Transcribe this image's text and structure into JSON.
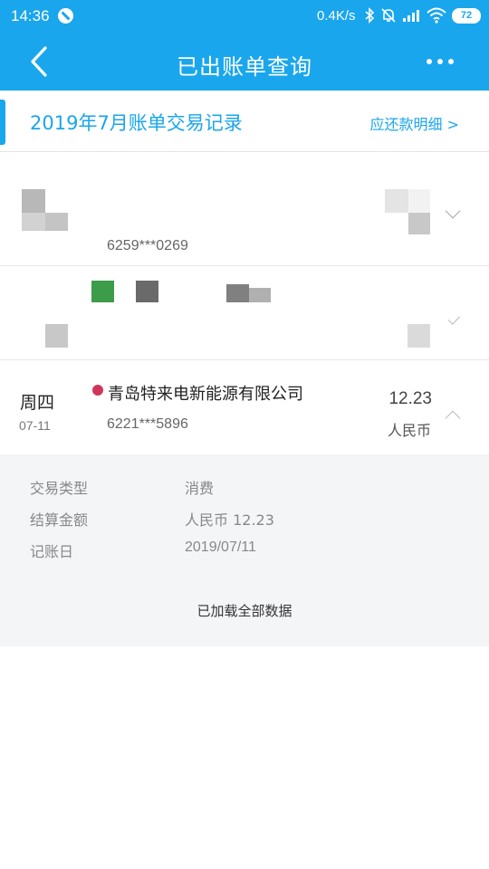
{
  "status_bar": {
    "time": "14:36",
    "network_speed": "0.4K/s",
    "battery": "72",
    "icons": [
      "notification-icon",
      "bluetooth-icon",
      "mute-icon",
      "signal-icon",
      "wifi-icon",
      "battery-icon"
    ]
  },
  "nav": {
    "title": "已出账单查询",
    "back_icon": "chevron-left-icon",
    "more_icon": "more-icon"
  },
  "bill": {
    "month_title": "2019年7月账单交易记录",
    "repay_link": "应还款明细 >"
  },
  "transactions": [
    {
      "card": "6259***0269",
      "expanded": false,
      "redacted": true
    },
    {
      "card": "",
      "expanded": false,
      "redacted": true
    },
    {
      "weekday": "周四",
      "date": "07-11",
      "merchant": "青岛特来电新能源有限公司",
      "card": "6221***5896",
      "amount": "12.23",
      "currency": "人民币",
      "expanded": true
    }
  ],
  "details": {
    "rows": [
      {
        "label": "交易类型",
        "value": "消费"
      },
      {
        "label": "结算金额",
        "value": "人民币 12.23"
      },
      {
        "label": "记账日",
        "value": "2019/07/11"
      }
    ],
    "footer": "已加载全部数据"
  },
  "colors": {
    "primary": "#1aa6ec",
    "merchant_dot": "#d0365a",
    "detail_bg": "#f4f5f7"
  }
}
